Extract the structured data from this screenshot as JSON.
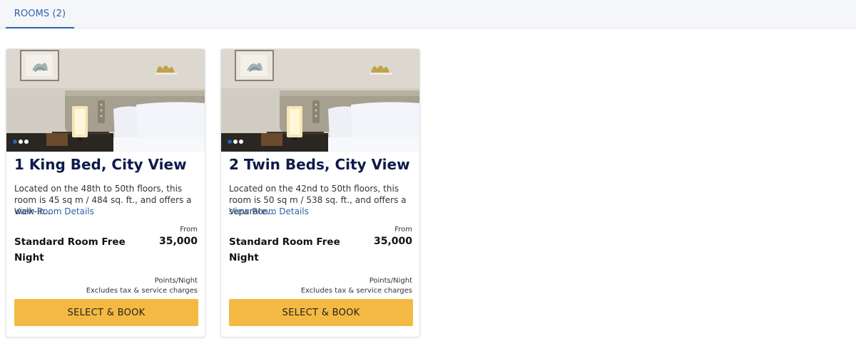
{
  "tabs": [
    {
      "label": "ROOMS (2)"
    }
  ],
  "rooms": [
    {
      "title": "1 King Bed, City View",
      "description": "Located on the 48th to 50th floors, this room is 45 sq m / 484 sq. ft., and offers a walk-in...",
      "details_link": "View Room Details",
      "rate_name": "Standard Room Free Night",
      "price_prefix": "From",
      "price": "35,000",
      "price_unit": "Points/Night",
      "price_note": "Excludes tax & service charges",
      "button_label": "SELECT & BOOK",
      "carousel_index": 1,
      "carousel_total": 3
    },
    {
      "title": "2 Twin Beds, City View",
      "description": "Located on the 42nd to 50th floors, this room is 50 sq m / 538 sq. ft., and offers a separate...",
      "details_link": "View Room Details",
      "rate_name": "Standard Room Free Night",
      "price_prefix": "From",
      "price": "35,000",
      "price_unit": "Points/Night",
      "price_note": "Excludes tax & service charges",
      "button_label": "SELECT & BOOK",
      "carousel_index": 1,
      "carousel_total": 3
    }
  ],
  "colors": {
    "accent": "#2a64ad",
    "title": "#0e1a4a",
    "button": "#f4b942",
    "tabbar_bg": "#f5f6f9"
  }
}
